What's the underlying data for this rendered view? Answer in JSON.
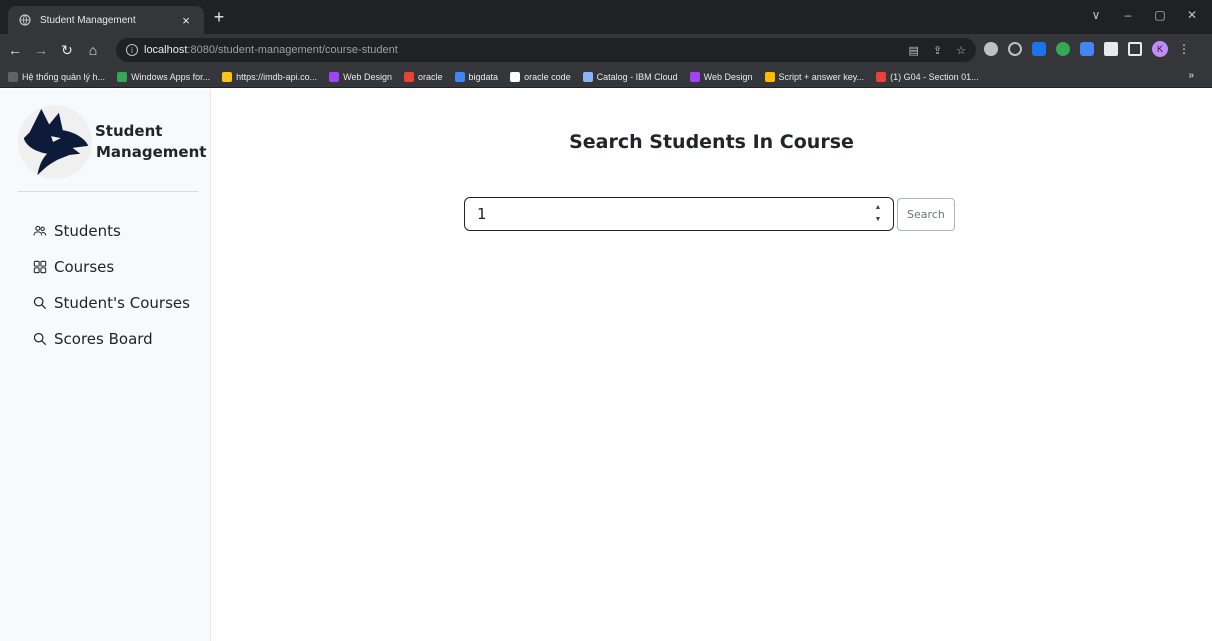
{
  "browser": {
    "tab_title": "Student Management",
    "tab_close": "×",
    "new_tab": "+",
    "url_host": "localhost",
    "url_rest": ":8080/student-management/course-student",
    "window_controls": [
      "∨",
      "–",
      "▢",
      "✕"
    ],
    "profile_initial": "K",
    "bookmarks": [
      {
        "label": "Hệ thống quản lý h...",
        "color": "#5f6368"
      },
      {
        "label": "Windows Apps for...",
        "color": "#34a853"
      },
      {
        "label": "https://imdb-api.co...",
        "color": "#f5c518"
      },
      {
        "label": "Web Design",
        "color": "#a142f4"
      },
      {
        "label": "oracle",
        "color": "#ea4335"
      },
      {
        "label": "bigdata",
        "color": "#4285f4"
      },
      {
        "label": "oracle code",
        "color": "#ffffff"
      },
      {
        "label": "Catalog - IBM Cloud",
        "color": "#8ab4f8"
      },
      {
        "label": "Web Design",
        "color": "#a142f4"
      },
      {
        "label": "Script + answer key...",
        "color": "#fbbc04"
      },
      {
        "label": "(1) G04 - Section 01...",
        "color": "#ea4335"
      }
    ],
    "bookmarks_more": "»"
  },
  "sidebar": {
    "brand_line1": "Student",
    "brand_line2": "Management",
    "items": [
      {
        "label": "Students",
        "icon": "people-icon"
      },
      {
        "label": "Courses",
        "icon": "grid-icon"
      },
      {
        "label": "Student's Courses",
        "icon": "search-icon"
      },
      {
        "label": "Scores Board",
        "icon": "search-icon"
      }
    ]
  },
  "main": {
    "title": "Search Students In Course",
    "course_input_value": "1",
    "search_button": "Search"
  }
}
